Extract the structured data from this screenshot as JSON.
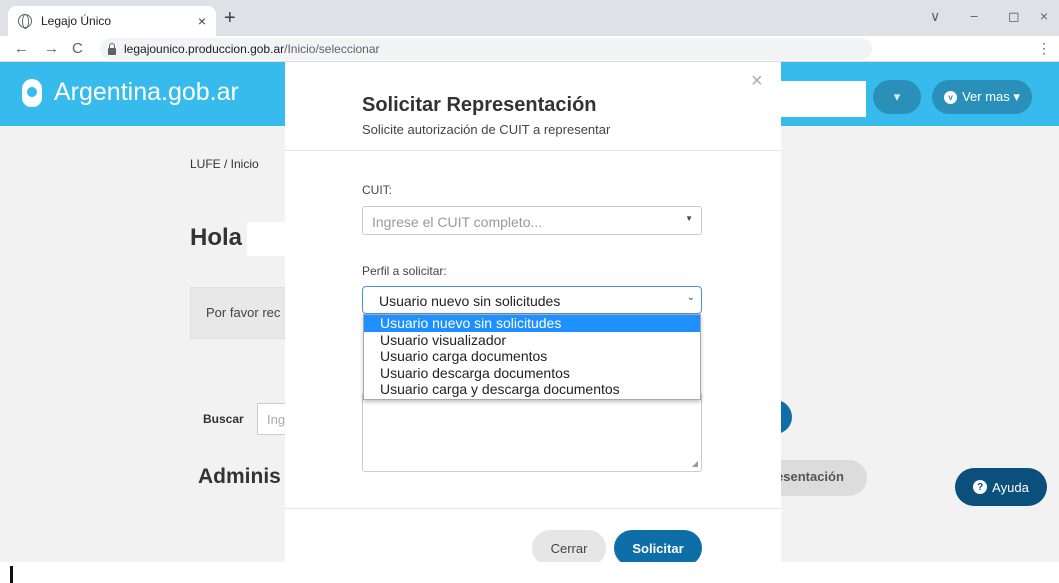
{
  "browser": {
    "tab_title": "Legajo Único",
    "tab_close": "×",
    "new_tab": "+",
    "url_domain": "legajounico.produccion.gob.ar",
    "url_path": "/Inicio/seleccionar",
    "back": "←",
    "forward": "→",
    "reload": "C",
    "menu": "⋮",
    "win_collapse": "∨",
    "win_minimize": "−",
    "win_restore": "◻",
    "win_close": "×"
  },
  "header": {
    "logo_text": "Argentina.gob.ar",
    "btn_small": "▾",
    "btn_vermas": "Ver mas ▾"
  },
  "page": {
    "breadcrumb": "LUFE  /  Inicio",
    "greeting": "Hola",
    "info_text": "Por favor rec",
    "search_label": "Buscar",
    "search_placeholder": "Ing",
    "section_title": "Adminis",
    "rep_button": "esentación",
    "help_button": "Ayuda"
  },
  "modal": {
    "close": "×",
    "title": "Solicitar Representación",
    "subtitle": "Solicite autorización de CUIT a representar",
    "cuit_label": "CUIT:",
    "cuit_placeholder": "Ingrese el CUIT completo...",
    "perfil_label": "Perfil a solicitar:",
    "perfil_selected": "Usuario nuevo sin solicitudes",
    "options": [
      "Usuario nuevo sin solicitudes",
      "Usuario visualizador",
      "Usuario carga documentos",
      "Usuario descarga documentos",
      "Usuario carga y descarga documentos"
    ],
    "btn_cerrar": "Cerrar",
    "btn_solicitar": "Solicitar"
  },
  "colors": {
    "header_blue": "#37bbed",
    "primary": "#0d6ea8",
    "help": "#0b4f7c",
    "option_highlight": "#1e90ff"
  }
}
